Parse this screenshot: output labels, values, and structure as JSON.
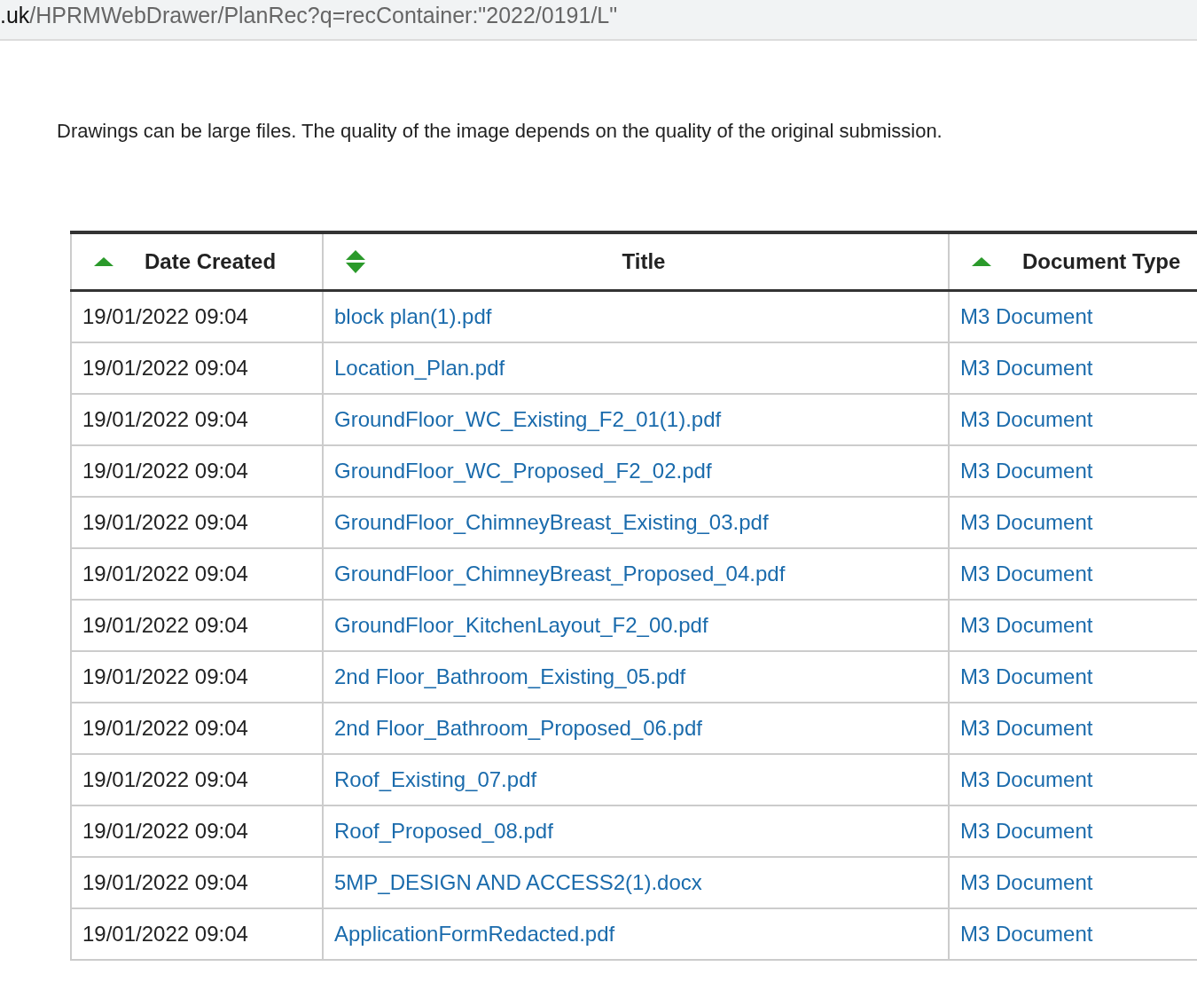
{
  "address_bar": {
    "host_end": ".uk",
    "path": "/HPRMWebDrawer/PlanRec?q=recContainer:\"2022/0191/L\""
  },
  "notice": "Drawings can be large files. The quality of the image depends on the quality of the original submission.",
  "table": {
    "columns": [
      {
        "label": "Date Created",
        "sorted": true
      },
      {
        "label": "Title",
        "sorted": false
      },
      {
        "label": "Document Type",
        "sorted": true
      }
    ],
    "rows": [
      {
        "date": "19/01/2022 09:04",
        "title": "block plan(1).pdf",
        "type": "M3 Document"
      },
      {
        "date": "19/01/2022 09:04",
        "title": "Location_Plan.pdf",
        "type": "M3 Document"
      },
      {
        "date": "19/01/2022 09:04",
        "title": "GroundFloor_WC_Existing_F2_01(1).pdf",
        "type": "M3 Document"
      },
      {
        "date": "19/01/2022 09:04",
        "title": "GroundFloor_WC_Proposed_F2_02.pdf",
        "type": "M3 Document"
      },
      {
        "date": "19/01/2022 09:04",
        "title": "GroundFloor_ChimneyBreast_Existing_03.pdf",
        "type": "M3 Document"
      },
      {
        "date": "19/01/2022 09:04",
        "title": "GroundFloor_ChimneyBreast_Proposed_04.pdf",
        "type": "M3 Document"
      },
      {
        "date": "19/01/2022 09:04",
        "title": "GroundFloor_KitchenLayout_F2_00.pdf",
        "type": "M3 Document"
      },
      {
        "date": "19/01/2022 09:04",
        "title": "2nd Floor_Bathroom_Existing_05.pdf",
        "type": "M3 Document"
      },
      {
        "date": "19/01/2022 09:04",
        "title": "2nd Floor_Bathroom_Proposed_06.pdf",
        "type": "M3 Document"
      },
      {
        "date": "19/01/2022 09:04",
        "title": "Roof_Existing_07.pdf",
        "type": "M3 Document"
      },
      {
        "date": "19/01/2022 09:04",
        "title": "Roof_Proposed_08.pdf",
        "type": "M3 Document"
      },
      {
        "date": "19/01/2022 09:04",
        "title": "5MP_DESIGN AND ACCESS2(1).docx",
        "type": "M3 Document"
      },
      {
        "date": "19/01/2022 09:04",
        "title": "ApplicationFormRedacted.pdf",
        "type": "M3 Document"
      }
    ]
  }
}
